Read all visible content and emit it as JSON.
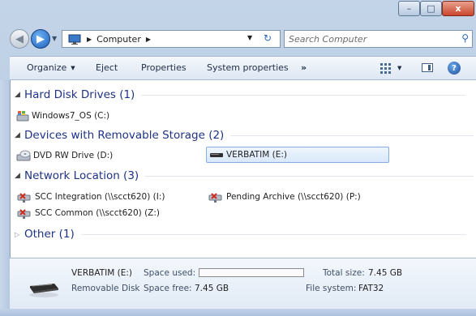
{
  "window": {
    "buttons": {
      "minimize": "–",
      "maximize": "□",
      "close": "x"
    }
  },
  "nav": {
    "back_icon": "◀",
    "forward_icon": "▶",
    "breadcrumb": [
      "Computer"
    ],
    "separator": "▶",
    "dropdown": "▼",
    "refresh": "↻",
    "search_placeholder": "Search Computer",
    "search_icon": "⚲"
  },
  "toolbar": {
    "organize": "Organize",
    "eject": "Eject",
    "properties": "Properties",
    "system_properties": "System properties",
    "more": "»",
    "help": "?"
  },
  "groups": {
    "hdd": {
      "label": "Hard Disk Drives (1)",
      "expanded": true
    },
    "removable": {
      "label": "Devices with Removable Storage (2)",
      "expanded": true
    },
    "network": {
      "label": "Network Location (3)",
      "expanded": true
    },
    "other": {
      "label": "Other (1)",
      "expanded": false
    }
  },
  "items": {
    "windows7": {
      "label": "Windows7_OS (C:)",
      "icon": "windows-drive-icon"
    },
    "dvd": {
      "label": "DVD RW Drive (D:)",
      "icon": "dvd-drive-icon"
    },
    "verbatim": {
      "label": "VERBATIM (E:)",
      "icon": "usb-drive-icon",
      "selected": true
    },
    "scc_integration": {
      "label": "SCC Integration (\\\\scct620) (I:)",
      "icon": "network-drive-disconnected-icon"
    },
    "pending_archive": {
      "label": "Pending Archive (\\\\scct620) (P:)",
      "icon": "network-drive-disconnected-icon"
    },
    "scc_common": {
      "label": "SCC Common (\\\\scct620) (Z:)",
      "icon": "network-drive-disconnected-icon"
    }
  },
  "details": {
    "name": "VERBATIM (E:)",
    "type": "Removable Disk",
    "space_used_label": "Space used:",
    "space_free_label": "Space free:",
    "space_free_value": "7.45 GB",
    "total_size_label": "Total size:",
    "total_size_value": "7.45 GB",
    "file_system_label": "File system:",
    "file_system_value": "FAT32",
    "used_fraction": 0.0
  },
  "colors": {
    "group_heading": "#1e3287",
    "selection_border": "#84acdd",
    "accent": "#2a6ab8"
  }
}
